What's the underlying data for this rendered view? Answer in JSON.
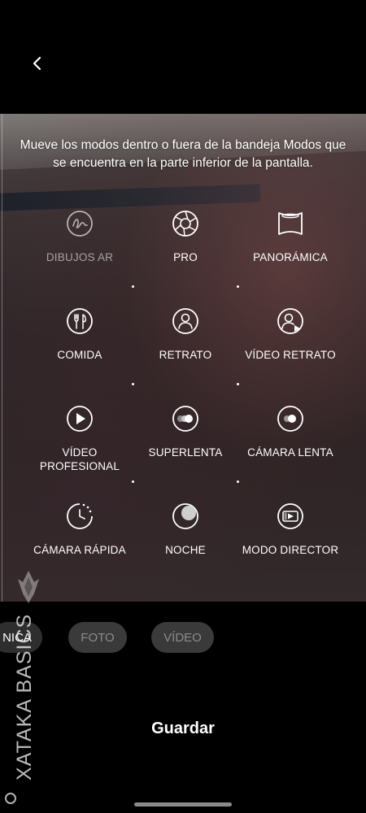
{
  "header": {
    "back_icon": "chevron-left-icon"
  },
  "info_text": "Mueve los modos dentro o fuera de la bandeja Modos que se encuentra en la parte inferior de la pantalla.",
  "modes": [
    {
      "label": "DIBUJOS AR",
      "icon": "ar-doodle-icon",
      "dimmed": true
    },
    {
      "label": "PRO",
      "icon": "aperture-icon"
    },
    {
      "label": "PANORÁMICA",
      "icon": "panorama-icon"
    },
    {
      "label": "COMIDA",
      "icon": "food-icon"
    },
    {
      "label": "RETRATO",
      "icon": "portrait-icon"
    },
    {
      "label": "VÍDEO RETRATO",
      "icon": "portrait-video-icon"
    },
    {
      "label": "VÍDEO PROFESIONAL",
      "icon": "play-circle-icon"
    },
    {
      "label": "SUPERLENTA",
      "icon": "super-slow-icon"
    },
    {
      "label": "CÁMARA LENTA",
      "icon": "slow-motion-icon"
    },
    {
      "label": "CÁMARA RÁPIDA",
      "icon": "hyperlapse-icon"
    },
    {
      "label": "NOCHE",
      "icon": "moon-icon"
    },
    {
      "label": "MODO DIRECTOR",
      "icon": "director-mode-icon"
    }
  ],
  "tray": {
    "items": [
      {
        "label": "NICA",
        "active": true
      },
      {
        "label": "FOTO"
      },
      {
        "label": "VÍDEO"
      }
    ]
  },
  "save_label": "Guardar",
  "watermark": {
    "text": "XATAKA BASICS"
  }
}
